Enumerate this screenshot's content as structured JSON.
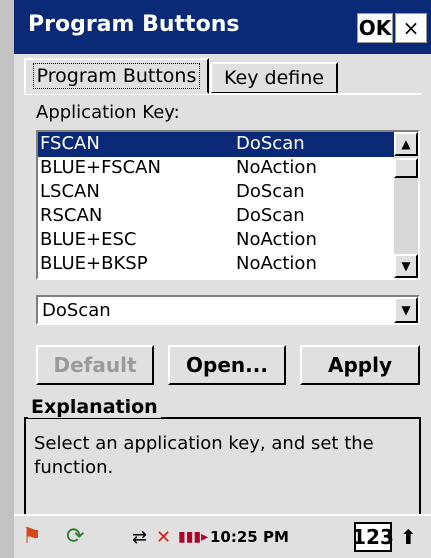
{
  "window": {
    "title": "Program Buttons",
    "ok_label": "OK",
    "close_label": "×"
  },
  "tabs": [
    {
      "label": "Program Buttons"
    },
    {
      "label": "Key define"
    }
  ],
  "app_key": {
    "label": "Application Key:",
    "rows": [
      {
        "key": "FSCAN",
        "action": "DoScan",
        "selected": true
      },
      {
        "key": "BLUE+FSCAN",
        "action": "NoAction"
      },
      {
        "key": "LSCAN",
        "action": "DoScan"
      },
      {
        "key": "RSCAN",
        "action": "DoScan"
      },
      {
        "key": "BLUE+ESC",
        "action": "NoAction"
      },
      {
        "key": "BLUE+BKSP",
        "action": "NoAction"
      }
    ]
  },
  "function_select": {
    "value": "DoScan"
  },
  "buttons": {
    "default": "Default",
    "open": "Open...",
    "apply": "Apply"
  },
  "explanation": {
    "title": "Explanation",
    "text": "Select an application key, and set the function."
  },
  "taskbar": {
    "time": "10:25 PM",
    "sip": "123"
  },
  "colors": {
    "title_bg": "#0a2a78",
    "selection_bg": "#0a2a78",
    "dialog_bg": "#e0e0e0"
  }
}
